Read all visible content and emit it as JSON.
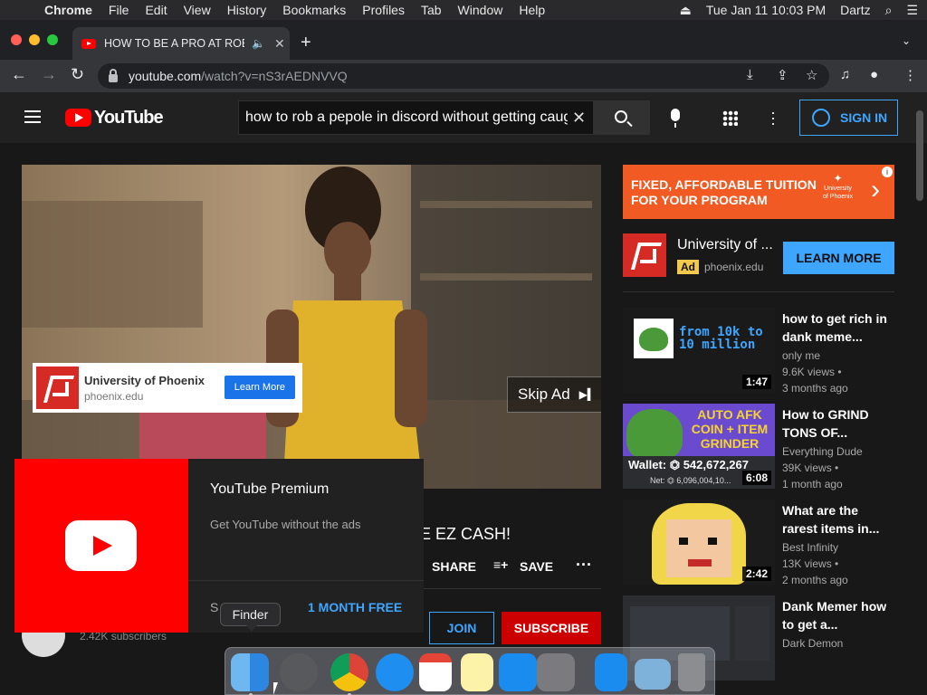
{
  "menubar": {
    "app": "Chrome",
    "items": [
      "File",
      "Edit",
      "View",
      "History",
      "Bookmarks",
      "Profiles",
      "Tab",
      "Window",
      "Help"
    ],
    "datetime": "Tue Jan 11  10:03 PM",
    "user": "Dartz"
  },
  "tab": {
    "title": "HOW TO BE A PRO AT ROB"
  },
  "omnibox": {
    "host": "youtube.com",
    "path": "/watch?v=nS3rAEDNVVQ"
  },
  "header": {
    "logo": "YouTube",
    "search_query": "how to rob a pepole in discord without getting caught",
    "signin": "SIGN IN"
  },
  "player": {
    "ad_name": "University of Phoenix",
    "ad_domain": "phoenix.edu",
    "ad_button": "Learn More",
    "skip_label": "Skip Ad"
  },
  "video": {
    "title_visible": "E EZ CASH!",
    "share": "SHARE",
    "save": "SAVE",
    "join": "JOIN",
    "subscribe": "SUBSCRIBE",
    "subscribers": "2.42K subscribers"
  },
  "premium": {
    "title": "YouTube Premium",
    "subtitle": "Get YouTube without the ads",
    "skip_partial": "S",
    "cta": "1 MONTH FREE"
  },
  "sidebar_ad": {
    "banner_text": [
      "FIXED, AFFORDABLE TUITION",
      "FOR YOUR PROGRAM"
    ],
    "banner_logo": [
      "University",
      "of Phoenix"
    ],
    "name": "University of ...",
    "badge": "Ad",
    "domain": "phoenix.edu",
    "cta": "LEARN MORE"
  },
  "recommendations": [
    {
      "title": "how to get rich in dank meme...",
      "channel": "only me",
      "views": "9.6K views •",
      "age": "3 months ago",
      "duration": "1:47",
      "thumb_text": [
        "from 10k to",
        "10 million"
      ]
    },
    {
      "title": "How to GRIND TONS OF...",
      "channel": "Everything Dude",
      "views": "39K views •",
      "age": "1 month ago",
      "duration": "6:08",
      "thumb_text": [
        "AUTO AFK",
        "COIN + ITEM",
        "GRINDER",
        "Wallet: ⏣ 542,672,267",
        "Net: ⏣ 6,096,004,10..."
      ]
    },
    {
      "title": "What are the rarest items in...",
      "channel": "Best Infinity",
      "views": "13K views •",
      "age": "2 months ago",
      "duration": "2:42",
      "thumb_text": []
    },
    {
      "title": "Dank Memer how to get a...",
      "channel": "Dark Demon",
      "views": "",
      "age": "",
      "duration": "",
      "thumb_text": []
    }
  ],
  "dock": {
    "tooltip": "Finder"
  },
  "colors": {
    "yt_red": "#ff0000",
    "link_blue": "#3ea6ff",
    "subscribe_red": "#cc0000",
    "phoenix_red": "#d62b24",
    "banner_orange": "#f15a22"
  }
}
